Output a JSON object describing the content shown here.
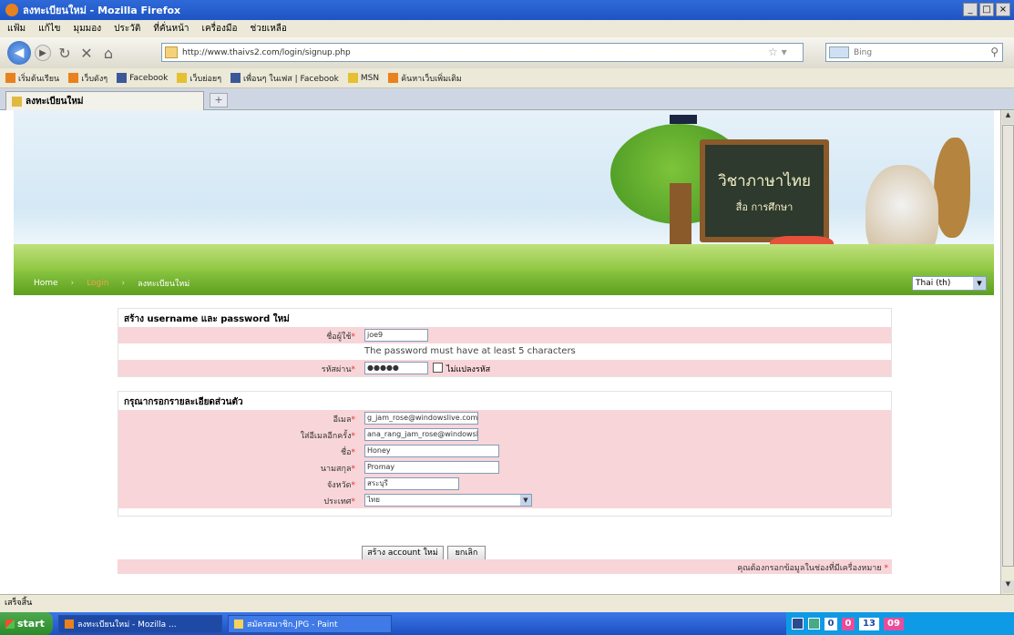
{
  "window": {
    "title": "ลงทะเบียนใหม่ - Mozilla Firefox",
    "controls": [
      "_",
      "□",
      "×"
    ]
  },
  "menu": [
    "แฟ้ม",
    "แก้ไข",
    "มุมมอง",
    "ประวัติ",
    "ที่คั่นหน้า",
    "เครื่องมือ",
    "ช่วยเหลือ"
  ],
  "toolbar": {
    "back_icon": "back-arrow-icon",
    "url": "http://www.thaivs2.com/login/signup.php",
    "search_placeholder": "Bing"
  },
  "bookmarks": [
    {
      "label": "เริ่มต้นเรียน",
      "color": "#e8821e"
    },
    {
      "label": "เว็บดังๆ",
      "color": "#e8821e"
    },
    {
      "label": "Facebook",
      "color": "#3b5998"
    },
    {
      "label": "เว็บย่อยๆ",
      "color": "#e6c02f"
    },
    {
      "label": "เพื่อนๆ ในเฟส | Facebook",
      "color": "#3b5998"
    },
    {
      "label": "MSN",
      "color": "#e6c02f"
    },
    {
      "label": "ค้นหาเว็บเพิ่มเติม",
      "color": "#e8821e"
    }
  ],
  "tab": {
    "label": "ลงทะเบียนใหม่",
    "new_tab": "+"
  },
  "banner": {
    "board_title": "วิชาภาษาไทย",
    "board_subtitle": "สื่อ การศึกษา"
  },
  "breadcrumb": {
    "home": "Home",
    "login": "Login",
    "current": "ลงทะเบียนใหม่"
  },
  "language": {
    "selected": "Thai (th)"
  },
  "account_section": {
    "heading": "สร้าง username และ password ใหม่",
    "username_label": "ชื่อผู้ใช้",
    "username_value": "joe9",
    "password_hint": "The password must have at least 5 characters",
    "password_label": "รหัสผ่าน",
    "password_value": "●●●●●",
    "unmask_label": "ไม่แปลงรหัส"
  },
  "details_section": {
    "heading": "กรุณากรอกรายละเอียดส่วนตัว",
    "email_label": "อีเมล",
    "email_value": "g_jam_rose@windowslive.com",
    "email2_label": "ใส่อีเมลอีกครั้ง",
    "email2_value": "ana_rang_jam_rose@windowsl",
    "firstname_label": "ชื่อ",
    "firstname_value": "Honey",
    "lastname_label": "นามสกุล",
    "lastname_value": "Promay",
    "city_label": "จังหวัด",
    "city_value": "สระบุรี",
    "country_label": "ประเทศ",
    "country_value": "ไทย"
  },
  "buttons": {
    "create": "สร้าง account ใหม่",
    "cancel": "ยกเลิก"
  },
  "footer_note": "คุณต้องกรอกข้อมูลในช่องที่มีเครื่องหมาย",
  "status": {
    "text": "เสร็จสิ้น"
  },
  "taskbar": {
    "start": "start",
    "items": [
      "ลงทะเบียนใหม่ - Mozilla ...",
      "สมัครสมาชิก.JPG - Paint"
    ],
    "tray_digits": [
      "0",
      "0",
      "13",
      "09"
    ]
  },
  "colors": {
    "accent_green": "#7ab536",
    "form_row_pink": "#f8d5d8",
    "required_star": "#d33333"
  }
}
